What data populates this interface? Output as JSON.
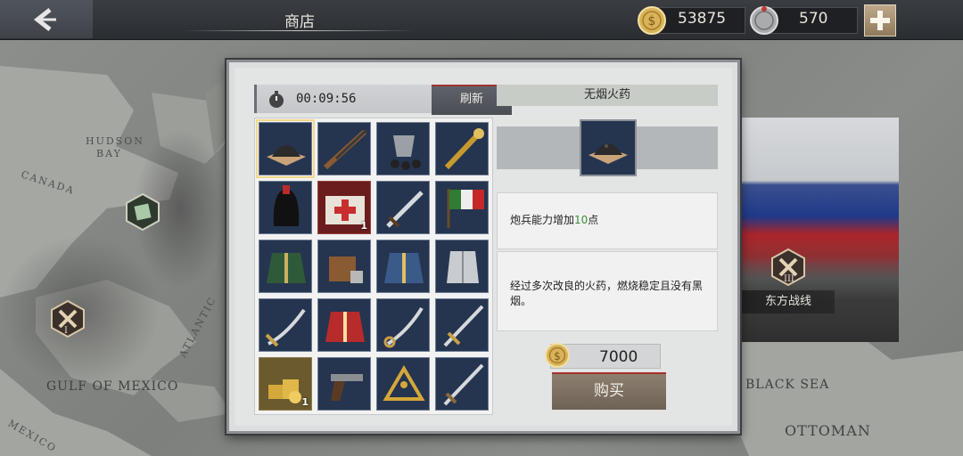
{
  "header": {
    "back_icon": "back-arrow-icon",
    "title": "商店",
    "gold": "53875",
    "silver": "570",
    "add_icon": "plus-icon"
  },
  "map": {
    "labels": [
      "HUDSON",
      "BAY",
      "CANADA",
      "GULF OF MEXICO",
      "MEXICO",
      "ATLANTIC",
      "BLACK SEA",
      "OTTOMAN"
    ],
    "front_numerals": [
      "I",
      "III"
    ],
    "front_label": "东方战线"
  },
  "shop": {
    "timer": "00:09:56",
    "refresh_label": "刷新",
    "items": [
      {
        "name": "smokeless-powder",
        "icon": "powder-pile-icon",
        "qty": ""
      },
      {
        "name": "rifle",
        "icon": "rifle-icon",
        "qty": ""
      },
      {
        "name": "cannonballs",
        "icon": "bucket-cannonballs-icon",
        "qty": ""
      },
      {
        "name": "baton",
        "icon": "marshal-baton-icon",
        "qty": ""
      },
      {
        "name": "busby-hat",
        "icon": "busby-hat-icon",
        "qty": ""
      },
      {
        "name": "medical-kit",
        "icon": "medical-kit-icon",
        "qty": "1"
      },
      {
        "name": "dagger",
        "icon": "dagger-icon",
        "qty": ""
      },
      {
        "name": "flag",
        "icon": "flag-icon",
        "qty": ""
      },
      {
        "name": "green-uniform",
        "icon": "green-uniform-icon",
        "qty": ""
      },
      {
        "name": "ammo-crate",
        "icon": "ammo-crate-icon",
        "qty": ""
      },
      {
        "name": "blue-uniform",
        "icon": "blue-uniform-icon",
        "qty": ""
      },
      {
        "name": "cuirass",
        "icon": "cuirass-icon",
        "qty": ""
      },
      {
        "name": "scimitar",
        "icon": "scimitar-icon",
        "qty": ""
      },
      {
        "name": "red-coat",
        "icon": "red-coat-icon",
        "qty": ""
      },
      {
        "name": "sabre",
        "icon": "sabre-icon",
        "qty": ""
      },
      {
        "name": "long-sword",
        "icon": "long-sword-icon",
        "qty": ""
      },
      {
        "name": "gold-coins",
        "icon": "gold-coins-icon",
        "qty": "1"
      },
      {
        "name": "revolver",
        "icon": "revolver-icon",
        "qty": ""
      },
      {
        "name": "sextant",
        "icon": "sextant-icon",
        "qty": ""
      },
      {
        "name": "sword",
        "icon": "sword-icon",
        "qty": ""
      }
    ]
  },
  "detail": {
    "title": "无烟火药",
    "icon": "powder-pile-icon",
    "effect_prefix": "炮兵能力增加",
    "effect_value": "10",
    "effect_suffix": "点",
    "description": "经过多次改良的火药，燃烧稳定且没有黑烟。",
    "price": "7000",
    "buy_label": "购买"
  },
  "colors": {
    "panel_bg": "#dcddde",
    "item_bg": "#25354f",
    "accent_red": "#a7312d",
    "highlight_green": "#3a8a3a",
    "selected_outline": "#f1d98a"
  }
}
